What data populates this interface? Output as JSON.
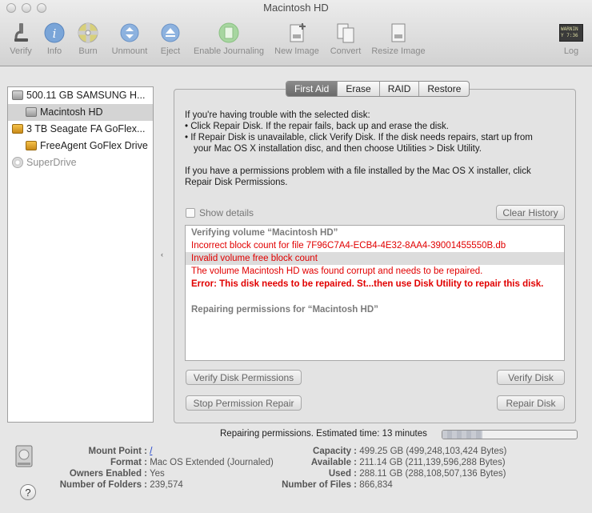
{
  "window": {
    "title": "Macintosh HD"
  },
  "toolbar": [
    {
      "label": "Verify",
      "icon": "microscope-icon"
    },
    {
      "label": "Info",
      "icon": "info-icon"
    },
    {
      "label": "Burn",
      "icon": "burn-icon"
    },
    {
      "label": "Unmount",
      "icon": "unmount-icon"
    },
    {
      "label": "Eject",
      "icon": "eject-icon"
    },
    {
      "label": "Enable Journaling",
      "icon": "journal-icon"
    },
    {
      "label": "New Image",
      "icon": "new-image-icon"
    },
    {
      "label": "Convert",
      "icon": "convert-icon"
    },
    {
      "label": "Resize Image",
      "icon": "resize-image-icon"
    },
    {
      "label": "Log",
      "icon": "log-icon"
    }
  ],
  "log_icon_text": "WARNIN\nY 7:36",
  "sidebar": {
    "items": [
      {
        "label": "500.11 GB SAMSUNG H..."
      },
      {
        "label": "Macintosh HD"
      },
      {
        "label": "3 TB Seagate FA GoFlex..."
      },
      {
        "label": "FreeAgent GoFlex Drive"
      },
      {
        "label": "SuperDrive"
      }
    ]
  },
  "tabs": [
    "First Aid",
    "Erase",
    "RAID",
    "Restore"
  ],
  "help": {
    "line1": "If you're having trouble with the selected disk:",
    "line2": "• Click Repair Disk. If the repair fails, back up and erase the disk.",
    "line3": "• If Repair Disk is unavailable, click Verify Disk. If the disk needs repairs, start up from",
    "line4": "your Mac OS X installation disc, and then choose Utilities > Disk Utility.",
    "line5": "If you have a permissions problem with a file installed by the Mac OS X installer, click",
    "line6": "Repair Disk Permissions."
  },
  "show_details": "Show details",
  "clear_history": "Clear History",
  "log": [
    "Verifying volume “Macintosh HD”",
    "Incorrect block count for file 7F96C7A4-ECB4-4E32-8AA4-39001455550B.db",
    "Invalid volume free block count",
    "The volume Macintosh HD was found corrupt and needs to be repaired.",
    "Error: This disk needs to be repaired. St...then use Disk Utility to repair this disk.",
    "Repairing permissions for “Macintosh HD”"
  ],
  "buttons": {
    "verify_permissions": "Verify Disk Permissions",
    "verify_disk": "Verify Disk",
    "stop_repair": "Stop Permission Repair",
    "repair_disk": "Repair Disk"
  },
  "status": {
    "text": "Repairing permissions. Estimated time: 13 minutes",
    "progress": 0.3
  },
  "info": {
    "mount_point_k": "Mount Point :",
    "mount_point_v": "/",
    "format_k": "Format :",
    "format_v": "Mac OS Extended (Journaled)",
    "owners_k": "Owners Enabled :",
    "owners_v": "Yes",
    "folders_k": "Number of Folders :",
    "folders_v": "239,574",
    "capacity_k": "Capacity :",
    "capacity_v": "499.25 GB (499,248,103,424 Bytes)",
    "available_k": "Available :",
    "available_v": "211.14 GB (211,139,596,288 Bytes)",
    "used_k": "Used :",
    "used_v": "288.11 GB (288,108,507,136 Bytes)",
    "files_k": "Number of Files :",
    "files_v": "866,834"
  },
  "help_button": "?"
}
